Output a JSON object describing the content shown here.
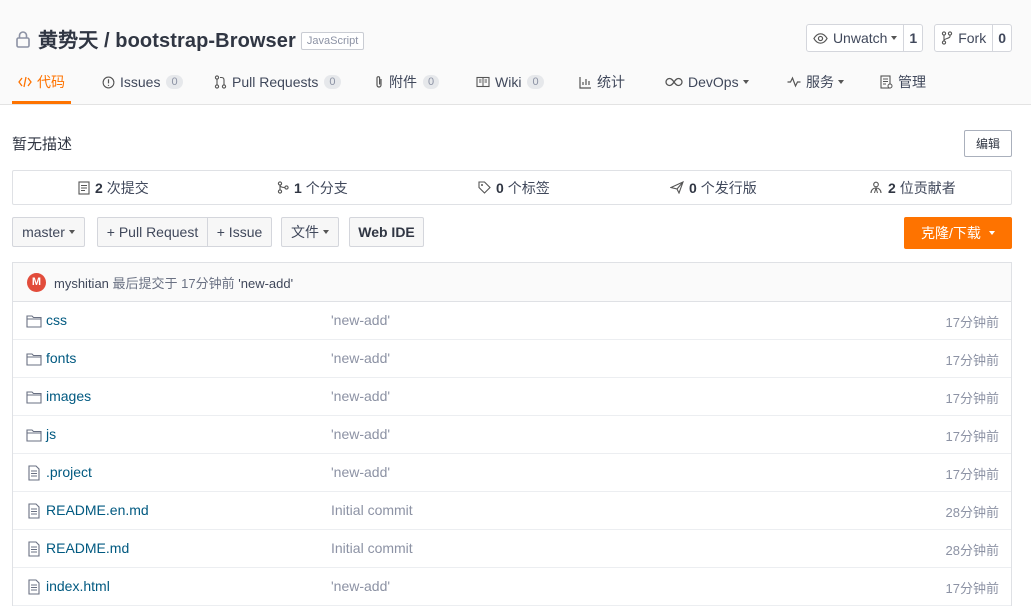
{
  "repo": {
    "title": "黄势天 / bootstrap-Browser",
    "language": "JavaScript"
  },
  "actions": {
    "watch_label": "Unwatch",
    "watch_count": "1",
    "fork_label": "Fork",
    "fork_count": "0"
  },
  "tabs": [
    {
      "label": "代码",
      "icon": "code-icon",
      "count": null,
      "active": true
    },
    {
      "label": "Issues",
      "icon": "issue-icon",
      "count": "0"
    },
    {
      "label": "Pull Requests",
      "icon": "pull-request-icon",
      "count": "0"
    },
    {
      "label": "附件",
      "icon": "attachment-icon",
      "count": "0"
    },
    {
      "label": "Wiki",
      "icon": "wiki-icon",
      "count": "0"
    },
    {
      "label": "统计",
      "icon": "chart-icon",
      "count": null
    },
    {
      "label": "DevOps",
      "icon": "infinity-icon",
      "count": null
    },
    {
      "label": "服务",
      "icon": "pulse-icon",
      "count": null
    },
    {
      "label": "管理",
      "icon": "settings-doc-icon",
      "count": null
    }
  ],
  "description": "暂无描述",
  "edit_label": "编辑",
  "stats": {
    "commits_num": "2",
    "commits_label": "次提交",
    "branches_num": "1",
    "branches_label": "个分支",
    "tags_num": "0",
    "tags_label": "个标签",
    "releases_num": "0",
    "releases_label": "个发行版",
    "contributors_num": "2",
    "contributors_label": "位贡献者"
  },
  "toolbar": {
    "branch": "master",
    "pull_request": "+ Pull Request",
    "issue": "+ Issue",
    "file": "文件",
    "web_ide": "Web IDE",
    "clone": "克隆/下载"
  },
  "last_commit": {
    "avatar_letter": "M",
    "author": "myshitian",
    "text": "最后提交于 17分钟前",
    "message": "'new-add'"
  },
  "files": [
    {
      "name": "css",
      "type": "folder",
      "commit": "'new-add'",
      "time": "17分钟前"
    },
    {
      "name": "fonts",
      "type": "folder",
      "commit": "'new-add'",
      "time": "17分钟前"
    },
    {
      "name": "images",
      "type": "folder",
      "commit": "'new-add'",
      "time": "17分钟前"
    },
    {
      "name": "js",
      "type": "folder",
      "commit": "'new-add'",
      "time": "17分钟前"
    },
    {
      "name": ".project",
      "type": "file",
      "commit": "'new-add'",
      "time": "17分钟前"
    },
    {
      "name": "README.en.md",
      "type": "file",
      "commit": "Initial commit",
      "time": "28分钟前"
    },
    {
      "name": "README.md",
      "type": "file",
      "commit": "Initial commit",
      "time": "28分钟前"
    },
    {
      "name": "index.html",
      "type": "file",
      "commit": "'new-add'",
      "time": "17分钟前"
    }
  ],
  "colors": {
    "accent": "#fe7300",
    "link": "#005980",
    "avatar": "#e24c3b"
  }
}
